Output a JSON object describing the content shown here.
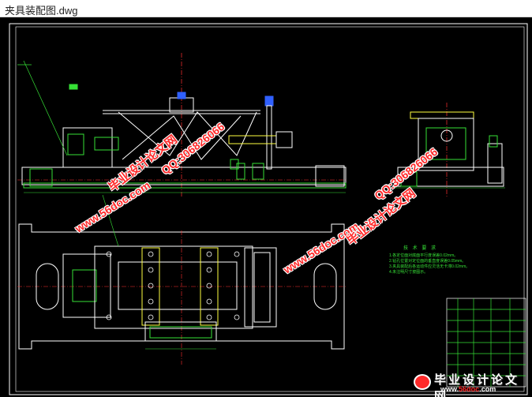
{
  "window": {
    "title": "夹具装配图.dwg"
  },
  "notes": {
    "heading": "技 术 要 求",
    "items": [
      "1.各定位面对底面平行度误差0.02mm。",
      "2.钻孔位置对定位面的垂直度误差0.05mm。",
      "3.夹具装配后各运动件应灵活无卡滞0.02mm。",
      "4.未注明尺寸按图示。"
    ]
  },
  "watermarks": {
    "site_url": "www.56doc.com",
    "site_name": "毕业设计论文网",
    "qq": "QQ:306826066"
  },
  "logo": {
    "name": "毕业设计论文网",
    "url_prefix": "www.",
    "url_brand": "56doc",
    "url_suffix": ".com"
  },
  "colors": {
    "background": "#000000",
    "outline": "#ffffff",
    "dimension": "#36e036",
    "centerline": "#ff3030",
    "hatch": "#ffff40",
    "accent": "#3060ff",
    "watermark": "#ff2a2a"
  }
}
